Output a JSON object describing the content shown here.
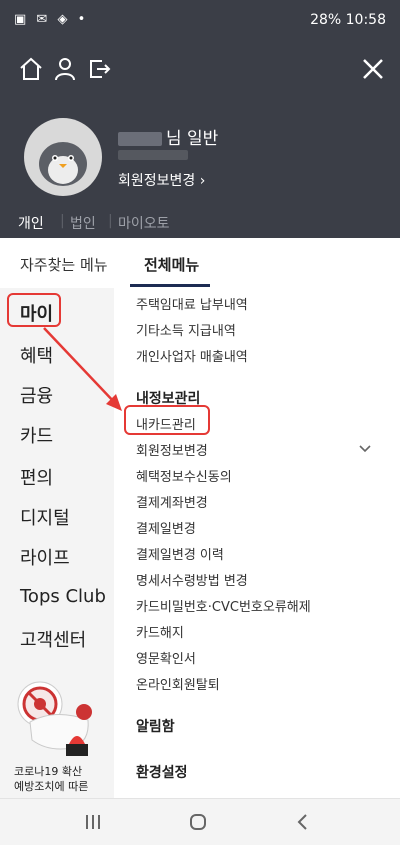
{
  "status": {
    "left_icons": "▣ ✉ ◈ •",
    "right": "28% 10:58"
  },
  "header": {
    "user_suffix": "님 일반",
    "edit_profile": "회원정보변경 ›"
  },
  "top_tabs": [
    "개인",
    "법인",
    "마이오토"
  ],
  "menu_tabs": [
    "자주찾는 메뉴",
    "전체메뉴"
  ],
  "left_menu": [
    "마이",
    "혜택",
    "금융",
    "카드",
    "편의",
    "디지털",
    "라이프",
    "Tops Club",
    "고객센터"
  ],
  "ad": {
    "line1": "코로나19 확산",
    "line2": "예방조치에 따른"
  },
  "content": {
    "items_top": [
      "주택임대료 납부내역",
      "기타소득 지급내역",
      "개인사업자 매출내역"
    ],
    "section1": "내정보관리",
    "section1_items": [
      "내카드관리",
      "회원정보변경",
      "혜택정보수신동의",
      "결제계좌변경",
      "결제일변경",
      "결제일변경 이력",
      "명세서수령방법 변경",
      "카드비밀번호·CVC번호오류해제",
      "카드해지",
      "영문확인서",
      "온라인회원탈퇴"
    ],
    "section2": "알림함",
    "section3": "환경설정"
  },
  "colors": {
    "header_bg": "#3b3e47",
    "highlight": "#e53935",
    "tab_underline": "#1d2b52"
  }
}
